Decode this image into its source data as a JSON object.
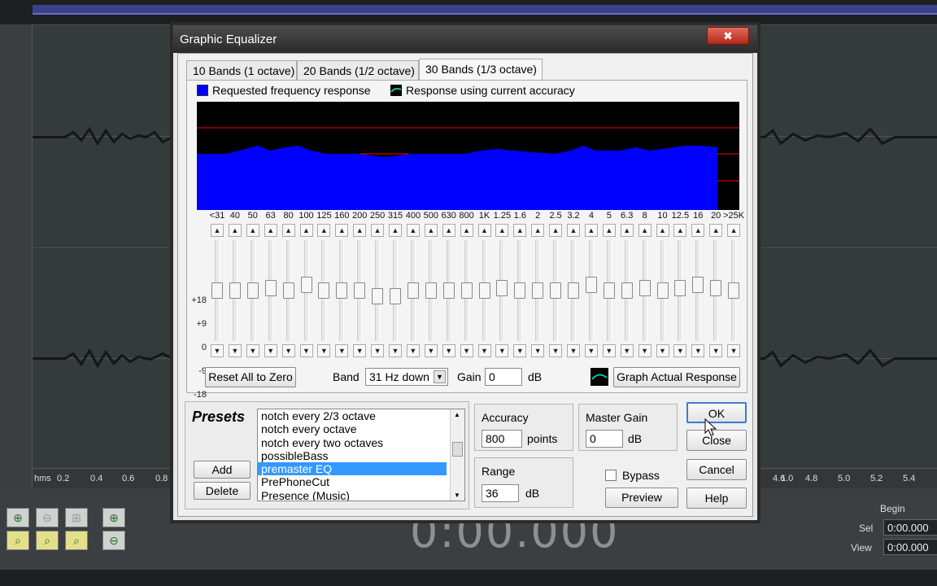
{
  "dialog": {
    "title": "Graphic Equalizer",
    "close_glyph": "✖",
    "tabs": [
      {
        "label": "10 Bands (1 octave)",
        "active": false
      },
      {
        "label": "20 Bands (1/2 octave)",
        "active": false
      },
      {
        "label": "30 Bands (1/3 octave)",
        "active": true
      }
    ],
    "legend": {
      "requested": "Requested frequency response",
      "actual": "Response using current accuracy"
    },
    "frequencies": [
      "<31",
      "40",
      "50",
      "63",
      "80",
      "100",
      "125",
      "160",
      "200",
      "250",
      "315",
      "400",
      "500",
      "630",
      "800",
      "1K",
      "1.25",
      "1.6",
      "2",
      "2.5",
      "3.2",
      "4",
      "5",
      "6.3",
      "8",
      "10",
      "12.5",
      "16",
      "20",
      ">25K"
    ],
    "gain_db": [
      0,
      0,
      0,
      1,
      0,
      2,
      0,
      0,
      0,
      -2,
      -2,
      0,
      0,
      0,
      0,
      0,
      1,
      0,
      0,
      0,
      0,
      2,
      0,
      0,
      1,
      0,
      1,
      2,
      1,
      0
    ],
    "scale": [
      "+18",
      "+9",
      "0",
      "-9",
      "-18"
    ],
    "controls": {
      "reset_label": "Reset All to Zero",
      "band_label": "Band",
      "band_value": "31 Hz down",
      "gain_label": "Gain",
      "gain_value": "0",
      "gain_unit": "dB",
      "graph_actual_label": "Graph Actual Response"
    },
    "presets": {
      "title": "Presets",
      "add_label": "Add",
      "delete_label": "Delete",
      "items": [
        "notch every 2/3 octave",
        "notch every octave",
        "notch every two octaves",
        "possibleBass",
        "premaster EQ",
        "PrePhoneCut",
        "Presence (Music)"
      ],
      "selected": "premaster EQ"
    },
    "accuracy": {
      "label": "Accuracy",
      "value": "800",
      "unit": "points"
    },
    "range": {
      "label": "Range",
      "value": "36",
      "unit": "dB"
    },
    "master_gain": {
      "label": "Master Gain",
      "value": "0",
      "unit": "dB"
    },
    "bypass_label": "Bypass",
    "preview_label": "Preview",
    "ok_label": "OK",
    "close_label": "Close",
    "cancel_label": "Cancel",
    "help_label": "Help",
    "colors": {
      "requested": "#0000ff",
      "actual": "#00c8a0",
      "graph_bg": "#000000",
      "ref_line": "#cc0000"
    }
  },
  "background": {
    "time_display": "0:00.000",
    "ruler_labels": [
      "hms",
      "0.2",
      "0.4",
      "0.6",
      "0.8",
      "1.0",
      "4.6",
      "4.8",
      "5.0",
      "5.2",
      "5.4"
    ],
    "sel_panel": {
      "begin_label": "Begin",
      "sel_label": "Sel",
      "view_label": "View",
      "sel_value": "0:00.000",
      "view_value": "0:00.000"
    }
  }
}
